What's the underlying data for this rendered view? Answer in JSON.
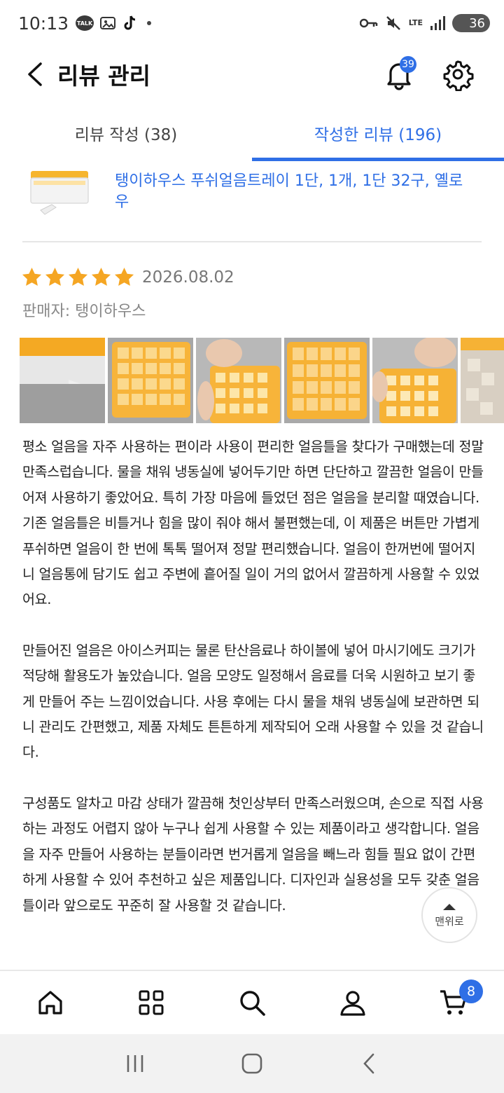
{
  "status_bar": {
    "time": "10:13",
    "talk_label": "TALK",
    "network": "LTE",
    "battery": "36"
  },
  "header": {
    "title": "리뷰 관리",
    "notification_count": "39"
  },
  "tabs": [
    {
      "label": "리뷰 작성 (38)",
      "active": false
    },
    {
      "label": "작성한 리뷰 (196)",
      "active": true
    }
  ],
  "product": {
    "name": "탱이하우스 푸쉬얼음트레이 1단, 1개, 1단 32구, 옐로우"
  },
  "review": {
    "rating": 5,
    "date": "2026.08.02",
    "seller": "판매자: 탱이하우스",
    "photo_count": 6,
    "paragraphs": [
      "평소 얼음을 자주 사용하는 편이라 사용이 편리한 얼음틀을 찾다가 구매했는데 정말 만족스럽습니다. 물을 채워 냉동실에 넣어두기만 하면 단단하고 깔끔한 얼음이 만들어져 사용하기 좋았어요. 특히 가장 마음에 들었던 점은 얼음을 분리할 때였습니다. 기존 얼음틀은 비틀거나 힘을 많이 줘야 해서 불편했는데, 이 제품은 버튼만 가볍게 푸쉬하면 얼음이 한 번에 톡톡 떨어져 정말 편리했습니다. 얼음이 한꺼번에 떨어지니 얼음통에 담기도 쉽고 주변에 흩어질 일이 거의 없어서 깔끔하게 사용할 수 있었어요.",
      "만들어진 얼음은 아이스커피는 물론 탄산음료나 하이볼에 넣어 마시기에도 크기가 적당해 활용도가 높았습니다. 얼음 모양도 일정해서 음료를 더욱 시원하고 보기 좋게 만들어 주는 느낌이었습니다. 사용 후에는 다시 물을 채워 냉동실에 보관하면 되니 관리도 간편했고, 제품 자체도 튼튼하게 제작되어 오래 사용할 수 있을 것 같습니다.",
      "구성품도 알차고 마감 상태가 깔끔해 첫인상부터 만족스러웠으며, 손으로 직접 사용하는 과정도 어렵지 않아 누구나 쉽게 사용할 수 있는 제품이라고 생각합니다. 얼음을 자주 만들어 사용하는 분들이라면 번거롭게 얼음을 빼느라 힘들 필요 없이 간편하게 사용할 수 있어 추천하고 싶은 제품입니다. 디자인과 실용성을 모두 갖춘 얼음틀이라 앞으로도 꾸준히 잘 사용할 것 같습니다."
    ]
  },
  "scroll_top": {
    "label": "맨위로"
  },
  "bottom_nav": {
    "items": [
      "home-icon",
      "category-grid-icon",
      "search-icon",
      "profile-icon",
      "cart-icon"
    ],
    "cart_count": "8"
  },
  "colors": {
    "accent": "#2f6fe6",
    "star": "#f5a623"
  }
}
